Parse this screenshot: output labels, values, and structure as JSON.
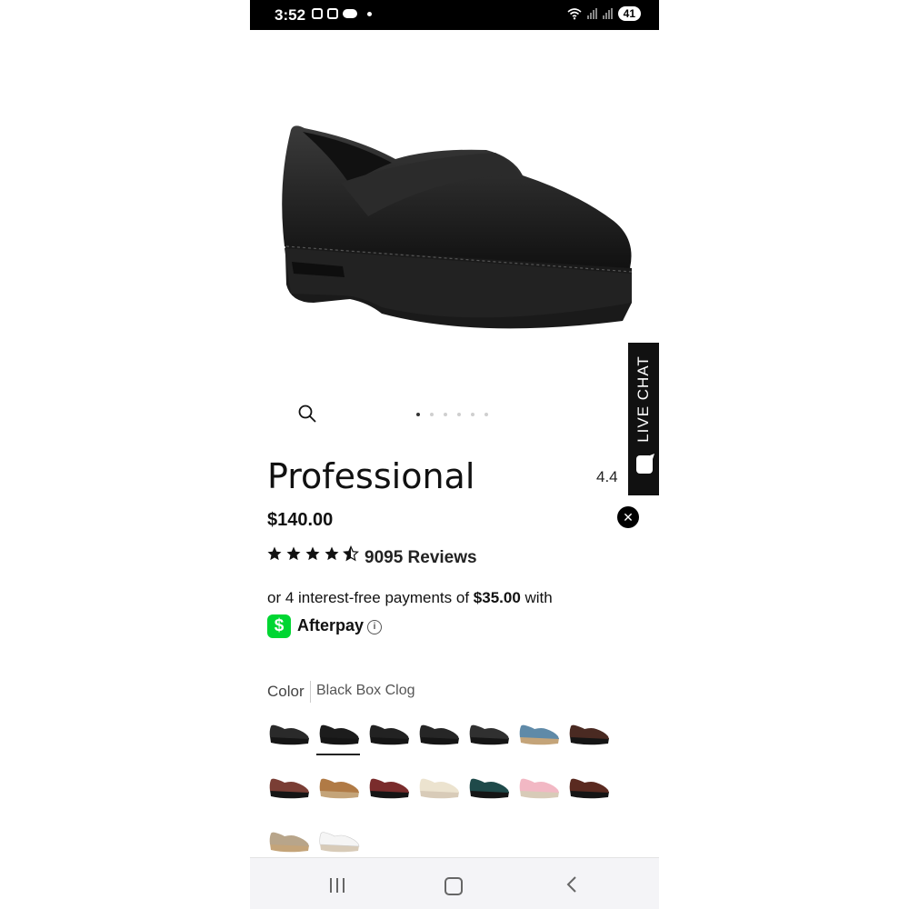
{
  "status_bar": {
    "time": "3:52",
    "battery": "41",
    "network_badge": "5"
  },
  "hero": {
    "image": "black-leather-clog-photo",
    "gallery_dots": 6,
    "active_dot": 1
  },
  "live_chat": {
    "label": "LIVE CHAT"
  },
  "product": {
    "title": "Professional",
    "price": "$140.00",
    "rating_value": "4.4",
    "star_rating": 4.5,
    "reviews_label": "9095 Reviews"
  },
  "afterpay": {
    "prefix": "or 4 interest-free payments of ",
    "amount": "$35.00",
    "suffix": " with",
    "brand": "Afterpay",
    "icon_glyph": "$",
    "info_glyph": "i"
  },
  "color": {
    "label": "Color",
    "selected": "Black Box Clog",
    "swatches": [
      {
        "name": "black-oiled",
        "color": "#2a2a2a"
      },
      {
        "name": "black-box",
        "color": "#1c1c1c"
      },
      {
        "name": "black-patent-1",
        "color": "#222"
      },
      {
        "name": "black-patent-2",
        "color": "#262626"
      },
      {
        "name": "black-patent-3",
        "color": "#303030"
      },
      {
        "name": "blue-tooled",
        "color": "#5f8aa8"
      },
      {
        "name": "brown",
        "color": "#4a2a22"
      },
      {
        "name": "burgundy-tooled",
        "color": "#7a3e35"
      },
      {
        "name": "tan",
        "color": "#b07a45"
      },
      {
        "name": "wine-patent",
        "color": "#7a2c2c"
      },
      {
        "name": "cream",
        "color": "#ece3cf"
      },
      {
        "name": "iridescent",
        "color": "#1f4a4a"
      },
      {
        "name": "pink",
        "color": "#f2b8c4"
      },
      {
        "name": "mahogany",
        "color": "#5a2a20"
      },
      {
        "name": "taupe",
        "color": "#b8a58a"
      },
      {
        "name": "white",
        "color": "#f5f5f5"
      }
    ]
  },
  "colors": {
    "accent": "#000000",
    "cashapp_green": "#00d632"
  }
}
